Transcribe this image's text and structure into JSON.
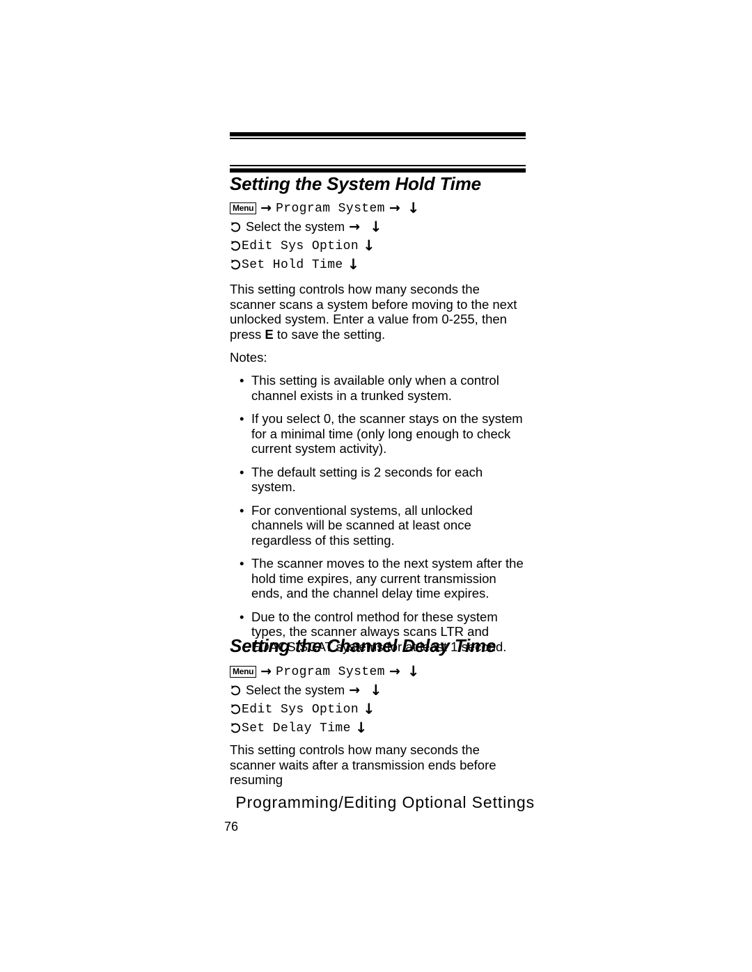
{
  "document": {
    "page_number": "76",
    "footer_title": "Programming/Editing Optional Settings"
  },
  "sections": [
    {
      "heading": "Setting the System Hold Time",
      "menu_path": {
        "key_label": "Menu",
        "rows": [
          {
            "item": "Program System",
            "mono": true
          },
          {
            "item": "Select the system",
            "mono": false
          },
          {
            "item": "Edit Sys Option",
            "mono": true
          },
          {
            "item": "Set Hold Time",
            "mono": true
          }
        ]
      },
      "description": "This setting controls how many seconds the scanner scans a system before moving to the next unlocked system. Enter a value from 0-255, then press ",
      "description_bold": "E",
      "description_tail": " to save the setting.",
      "notes_label": "Notes:",
      "notes": [
        "This setting is available only when a control channel exists in a trunked system.",
        "If you select 0, the scanner stays on the system for a minimal time (only long enough to check current system activity).",
        "The default setting is 2 seconds for each system.",
        "For conventional systems, all unlocked channels will be scanned at least once regardless of this setting.",
        "The scanner moves to the next system after the hold time expires, any current transmission ends, and the channel delay time expires.",
        "Due to the control method for these system types, the scanner always scans LTR and EDACS SCAT systems for at least 1 second."
      ]
    },
    {
      "heading": "Setting the Channel Delay Time",
      "menu_path": {
        "key_label": "Menu",
        "rows": [
          {
            "item": "Program System",
            "mono": true
          },
          {
            "item": "Select the system",
            "mono": false
          },
          {
            "item": "Edit Sys Option",
            "mono": true
          },
          {
            "item": "Set Delay Time",
            "mono": true
          }
        ]
      },
      "description": "This setting controls how many seconds the scanner waits after a transmission ends before resuming"
    }
  ],
  "glyphs": {
    "arrow_right": "→",
    "arrow_down": "↓",
    "bullet": "•"
  }
}
